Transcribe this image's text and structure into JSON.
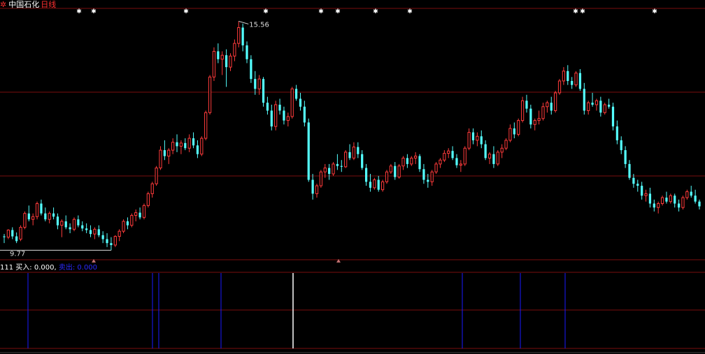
{
  "header": {
    "stock_name": "中国石化",
    "period": "日线",
    "gear_icon": "gear-icon"
  },
  "colors": {
    "background": "#000000",
    "up": "#ff3b3b",
    "down": "#54ffff",
    "grid": "#7a0e0e",
    "text": "#ffffff",
    "buy_line": "#ffffff",
    "sell_line": "#1a1aff"
  },
  "indicator": {
    "name": "111",
    "buy_label": "买入:",
    "buy_value": "0.000,",
    "sell_label": "卖出:",
    "sell_value": "0.000"
  },
  "chart_data": [
    {
      "type": "candlestick",
      "price_range": [
        9.6,
        15.85
      ],
      "max_annotation": "15.56",
      "min_annotation": "9.77",
      "candles": [
        [
          10.12,
          10.18,
          9.95,
          10.1
        ],
        [
          10.1,
          10.3,
          10.05,
          10.28
        ],
        [
          10.28,
          10.35,
          10.05,
          10.12
        ],
        [
          10.12,
          10.22,
          9.95,
          10.0
        ],
        [
          10.05,
          10.4,
          10.0,
          10.35
        ],
        [
          10.35,
          10.75,
          10.3,
          10.7
        ],
        [
          10.7,
          10.9,
          10.5,
          10.55
        ],
        [
          10.55,
          10.7,
          10.4,
          10.62
        ],
        [
          10.62,
          11.0,
          10.55,
          10.95
        ],
        [
          10.95,
          11.05,
          10.65,
          10.7
        ],
        [
          10.7,
          10.85,
          10.5,
          10.55
        ],
        [
          10.55,
          10.75,
          10.45,
          10.7
        ],
        [
          10.7,
          10.85,
          10.55,
          10.62
        ],
        [
          10.62,
          10.7,
          10.3,
          10.4
        ],
        [
          10.4,
          10.55,
          10.1,
          10.5
        ],
        [
          10.5,
          10.65,
          10.3,
          10.35
        ],
        [
          10.35,
          10.45,
          10.2,
          10.3
        ],
        [
          10.3,
          10.6,
          10.25,
          10.55
        ],
        [
          10.55,
          10.65,
          10.35,
          10.4
        ],
        [
          10.4,
          10.5,
          10.25,
          10.32
        ],
        [
          10.32,
          10.45,
          10.2,
          10.28
        ],
        [
          10.28,
          10.4,
          10.1,
          10.18
        ],
        [
          10.18,
          10.35,
          10.05,
          10.3
        ],
        [
          10.3,
          10.4,
          10.1,
          10.15
        ],
        [
          10.15,
          10.25,
          9.95,
          10.05
        ],
        [
          10.05,
          10.2,
          9.85,
          9.95
        ],
        [
          9.95,
          10.1,
          9.77,
          9.9
        ],
        [
          9.9,
          10.15,
          9.85,
          10.12
        ],
        [
          10.12,
          10.3,
          10.0,
          10.25
        ],
        [
          10.25,
          10.55,
          10.2,
          10.5
        ],
        [
          10.5,
          10.6,
          10.3,
          10.4
        ],
        [
          10.4,
          10.7,
          10.35,
          10.65
        ],
        [
          10.65,
          10.8,
          10.5,
          10.72
        ],
        [
          10.72,
          10.85,
          10.55,
          10.6
        ],
        [
          10.6,
          10.95,
          10.55,
          10.9
        ],
        [
          10.9,
          11.25,
          10.85,
          11.2
        ],
        [
          11.2,
          11.5,
          11.1,
          11.45
        ],
        [
          11.45,
          11.9,
          11.4,
          11.85
        ],
        [
          11.85,
          12.4,
          11.8,
          12.3
        ],
        [
          12.3,
          12.55,
          12.05,
          12.15
        ],
        [
          12.15,
          12.35,
          11.95,
          12.3
        ],
        [
          12.3,
          12.6,
          12.2,
          12.5
        ],
        [
          12.5,
          12.7,
          12.25,
          12.4
        ],
        [
          12.4,
          12.55,
          12.2,
          12.48
        ],
        [
          12.48,
          12.6,
          12.3,
          12.35
        ],
        [
          12.35,
          12.7,
          12.25,
          12.6
        ],
        [
          12.6,
          12.75,
          12.35,
          12.42
        ],
        [
          12.42,
          12.55,
          12.1,
          12.2
        ],
        [
          12.2,
          12.65,
          12.15,
          12.6
        ],
        [
          12.6,
          13.3,
          12.55,
          13.25
        ],
        [
          13.25,
          14.2,
          13.2,
          14.15
        ],
        [
          14.15,
          14.9,
          14.05,
          14.8
        ],
        [
          14.8,
          15.0,
          14.5,
          14.6
        ],
        [
          14.6,
          14.8,
          14.2,
          14.7
        ],
        [
          14.7,
          14.85,
          13.9,
          14.4
        ],
        [
          14.4,
          14.75,
          14.3,
          14.68
        ],
        [
          14.68,
          15.1,
          14.55,
          15.0
        ],
        [
          15.0,
          15.56,
          14.9,
          15.4
        ],
        [
          15.4,
          15.5,
          14.8,
          14.95
        ],
        [
          14.95,
          15.05,
          14.5,
          14.6
        ],
        [
          14.6,
          14.7,
          14.0,
          14.1
        ],
        [
          14.1,
          14.3,
          13.7,
          13.85
        ],
        [
          13.85,
          14.2,
          13.7,
          14.1
        ],
        [
          14.1,
          14.15,
          13.4,
          13.5
        ],
        [
          13.5,
          13.65,
          13.2,
          13.3
        ],
        [
          13.3,
          13.45,
          12.8,
          12.9
        ],
        [
          12.9,
          13.55,
          12.8,
          13.45
        ],
        [
          13.45,
          13.6,
          13.2,
          13.3
        ],
        [
          13.3,
          13.4,
          12.95,
          13.05
        ],
        [
          13.05,
          13.25,
          12.9,
          13.15
        ],
        [
          13.15,
          13.9,
          13.1,
          13.85
        ],
        [
          13.85,
          13.95,
          13.55,
          13.6
        ],
        [
          13.6,
          13.75,
          13.3,
          13.4
        ],
        [
          13.4,
          13.55,
          12.9,
          13.0
        ],
        [
          13.0,
          13.1,
          11.5,
          11.55
        ],
        [
          11.55,
          11.7,
          11.05,
          11.2
        ],
        [
          11.2,
          11.45,
          11.1,
          11.4
        ],
        [
          11.4,
          11.8,
          11.35,
          11.75
        ],
        [
          11.75,
          11.95,
          11.6,
          11.85
        ],
        [
          11.85,
          11.95,
          11.55,
          11.7
        ],
        [
          11.7,
          12.0,
          11.65,
          11.95
        ],
        [
          11.95,
          12.2,
          11.8,
          11.9
        ],
        [
          11.9,
          12.05,
          11.75,
          11.88
        ],
        [
          11.88,
          12.3,
          11.85,
          12.25
        ],
        [
          12.25,
          12.45,
          12.05,
          12.1
        ],
        [
          12.1,
          12.5,
          12.05,
          12.38
        ],
        [
          12.38,
          12.5,
          12.1,
          12.2
        ],
        [
          12.2,
          12.3,
          11.8,
          11.85
        ],
        [
          11.85,
          11.95,
          11.4,
          11.5
        ],
        [
          11.5,
          11.7,
          11.25,
          11.35
        ],
        [
          11.35,
          11.6,
          11.3,
          11.55
        ],
        [
          11.55,
          11.65,
          11.25,
          11.3
        ],
        [
          11.3,
          11.55,
          11.25,
          11.5
        ],
        [
          11.5,
          11.8,
          11.45,
          11.75
        ],
        [
          11.75,
          11.95,
          11.7,
          11.9
        ],
        [
          11.9,
          12.0,
          11.55,
          11.62
        ],
        [
          11.62,
          11.95,
          11.58,
          11.9
        ],
        [
          11.9,
          12.15,
          11.8,
          12.1
        ],
        [
          12.1,
          12.2,
          11.85,
          11.95
        ],
        [
          11.95,
          12.15,
          11.9,
          12.1
        ],
        [
          12.1,
          12.25,
          11.95,
          12.15
        ],
        [
          12.15,
          12.2,
          11.75,
          11.82
        ],
        [
          11.82,
          11.95,
          11.45,
          11.55
        ],
        [
          11.55,
          11.7,
          11.35,
          11.5
        ],
        [
          11.5,
          11.8,
          11.4,
          11.75
        ],
        [
          11.75,
          12.0,
          11.7,
          11.95
        ],
        [
          11.95,
          12.1,
          11.85,
          12.05
        ],
        [
          12.05,
          12.3,
          12.0,
          12.22
        ],
        [
          12.22,
          12.35,
          12.1,
          12.28
        ],
        [
          12.28,
          12.4,
          12.05,
          12.1
        ],
        [
          12.1,
          12.2,
          11.85,
          11.92
        ],
        [
          11.92,
          12.05,
          11.75,
          11.95
        ],
        [
          11.95,
          12.4,
          11.9,
          12.35
        ],
        [
          12.35,
          12.85,
          12.3,
          12.75
        ],
        [
          12.75,
          12.85,
          12.45,
          12.55
        ],
        [
          12.55,
          12.75,
          12.4,
          12.65
        ],
        [
          12.65,
          12.8,
          12.35,
          12.45
        ],
        [
          12.45,
          12.55,
          12.05,
          12.1
        ],
        [
          12.1,
          12.25,
          11.95,
          12.2
        ],
        [
          12.2,
          12.4,
          11.85,
          11.95
        ],
        [
          11.95,
          12.3,
          11.9,
          12.25
        ],
        [
          12.25,
          12.45,
          12.1,
          12.35
        ],
        [
          12.35,
          12.6,
          12.3,
          12.55
        ],
        [
          12.55,
          12.95,
          12.5,
          12.85
        ],
        [
          12.85,
          13.0,
          12.6,
          12.7
        ],
        [
          12.7,
          13.1,
          12.65,
          13.05
        ],
        [
          13.05,
          13.65,
          13.0,
          13.55
        ],
        [
          13.55,
          13.7,
          13.25,
          13.35
        ],
        [
          13.35,
          13.45,
          12.85,
          12.95
        ],
        [
          12.95,
          13.1,
          12.8,
          13.05
        ],
        [
          13.05,
          13.3,
          12.95,
          13.1
        ],
        [
          13.1,
          13.5,
          13.05,
          13.4
        ],
        [
          13.4,
          13.55,
          13.25,
          13.5
        ],
        [
          13.5,
          13.65,
          13.2,
          13.3
        ],
        [
          13.3,
          13.8,
          13.25,
          13.75
        ],
        [
          13.75,
          14.1,
          13.7,
          14.05
        ],
        [
          14.05,
          14.4,
          13.95,
          14.3
        ],
        [
          14.3,
          14.45,
          13.95,
          14.05
        ],
        [
          14.05,
          14.15,
          13.85,
          13.95
        ],
        [
          13.95,
          14.3,
          13.9,
          14.25
        ],
        [
          14.25,
          14.35,
          13.8,
          13.85
        ],
        [
          13.85,
          14.0,
          13.2,
          13.3
        ],
        [
          13.3,
          13.55,
          13.2,
          13.5
        ],
        [
          13.5,
          13.75,
          13.4,
          13.45
        ],
        [
          13.45,
          13.6,
          13.3,
          13.55
        ],
        [
          13.55,
          13.65,
          13.15,
          13.25
        ],
        [
          13.25,
          13.5,
          13.2,
          13.45
        ],
        [
          13.45,
          13.6,
          13.35,
          13.4
        ],
        [
          13.4,
          13.5,
          12.8,
          12.9
        ],
        [
          12.9,
          13.05,
          12.45,
          12.55
        ],
        [
          12.55,
          12.65,
          12.2,
          12.3
        ],
        [
          12.3,
          12.4,
          11.85,
          11.95
        ],
        [
          11.95,
          12.05,
          11.55,
          11.6
        ],
        [
          11.6,
          11.7,
          11.35,
          11.45
        ],
        [
          11.45,
          11.55,
          11.25,
          11.4
        ],
        [
          11.4,
          11.5,
          11.05,
          11.15
        ],
        [
          11.15,
          11.3,
          11.0,
          11.2
        ],
        [
          11.2,
          11.35,
          10.85,
          10.95
        ],
        [
          10.95,
          11.05,
          10.75,
          10.85
        ],
        [
          10.85,
          11.0,
          10.7,
          10.95
        ],
        [
          10.95,
          11.15,
          10.9,
          11.1
        ],
        [
          11.1,
          11.25,
          10.95,
          11.0
        ],
        [
          11.0,
          11.2,
          10.95,
          11.15
        ],
        [
          11.15,
          11.2,
          10.85,
          10.95
        ],
        [
          10.95,
          11.05,
          10.75,
          10.85
        ],
        [
          10.85,
          11.15,
          10.8,
          11.1
        ],
        [
          11.1,
          11.3,
          11.05,
          11.25
        ],
        [
          11.25,
          11.4,
          11.1,
          11.15
        ],
        [
          11.15,
          11.3,
          10.95,
          11.0
        ],
        [
          11.0,
          11.05,
          10.8,
          10.88
        ]
      ]
    },
    {
      "type": "bar",
      "series": [
        {
          "name": "买入",
          "values": [
            0.0
          ]
        },
        {
          "name": "卖出",
          "values": [
            0.0
          ]
        }
      ]
    }
  ]
}
